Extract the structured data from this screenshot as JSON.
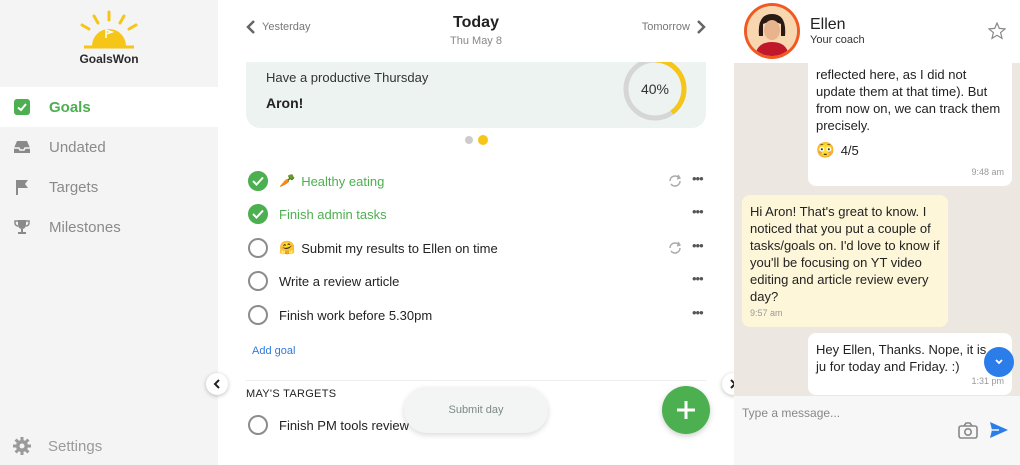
{
  "app": {
    "logo_text": "GoalsWon"
  },
  "sidebar": {
    "items": [
      {
        "label": "Goals",
        "icon": "check-square-icon",
        "active": true
      },
      {
        "label": "Undated",
        "icon": "inbox-icon",
        "active": false
      },
      {
        "label": "Targets",
        "icon": "flag-icon",
        "active": false
      },
      {
        "label": "Milestones",
        "icon": "trophy-icon",
        "active": false
      }
    ],
    "settings_label": "Settings"
  },
  "datebar": {
    "prev": "Yesterday",
    "title": "Today",
    "subtitle": "Thu May 8",
    "next": "Tomorrow"
  },
  "card": {
    "line1": "Have a productive Thursday",
    "line2": "Aron!",
    "progress_label": "40%",
    "progress": 0.4
  },
  "tasks": [
    {
      "emoji": "🥕",
      "text": "Healthy eating",
      "done": true,
      "repeat": true
    },
    {
      "emoji": "",
      "text": "Finish admin tasks",
      "done": true,
      "repeat": false
    },
    {
      "emoji": "🤗",
      "text": "Submit my results to Ellen on time",
      "done": false,
      "repeat": true
    },
    {
      "emoji": "",
      "text": "Write a review article",
      "done": false,
      "repeat": false
    },
    {
      "emoji": "",
      "text": "Finish work before 5.30pm",
      "done": false,
      "repeat": false
    }
  ],
  "more_glyph": "•••",
  "add_goal": "Add goal",
  "targets": {
    "title": "MAY'S TARGETS",
    "items": [
      {
        "text": "Finish PM tools review"
      }
    ]
  },
  "submit_day": "Submit day",
  "chat": {
    "name": "Ellen",
    "role": "Your coach",
    "messages": [
      {
        "text": "reflected here, as I did not update them at that time). But from now on, we can track them precisely.",
        "emoji": "😳",
        "extra": "4/5",
        "time": "9:48 am"
      },
      {
        "text": "Hi Aron! That's great to know. I noticed that you put a couple of tasks/goals on. I'd love to know if you'll be focusing on YT video editing and article review every day?",
        "time": "9:57 am"
      },
      {
        "text": "Hey Ellen, Thanks. Nope, it is ju for today and Friday. :)",
        "time": "1:31 pm"
      }
    ],
    "input_placeholder": "Type a message..."
  },
  "colors": {
    "accent": "#4caf50",
    "progress": "#f5c518",
    "link": "#2f7bd8",
    "brand_orange": "#f05a22"
  }
}
